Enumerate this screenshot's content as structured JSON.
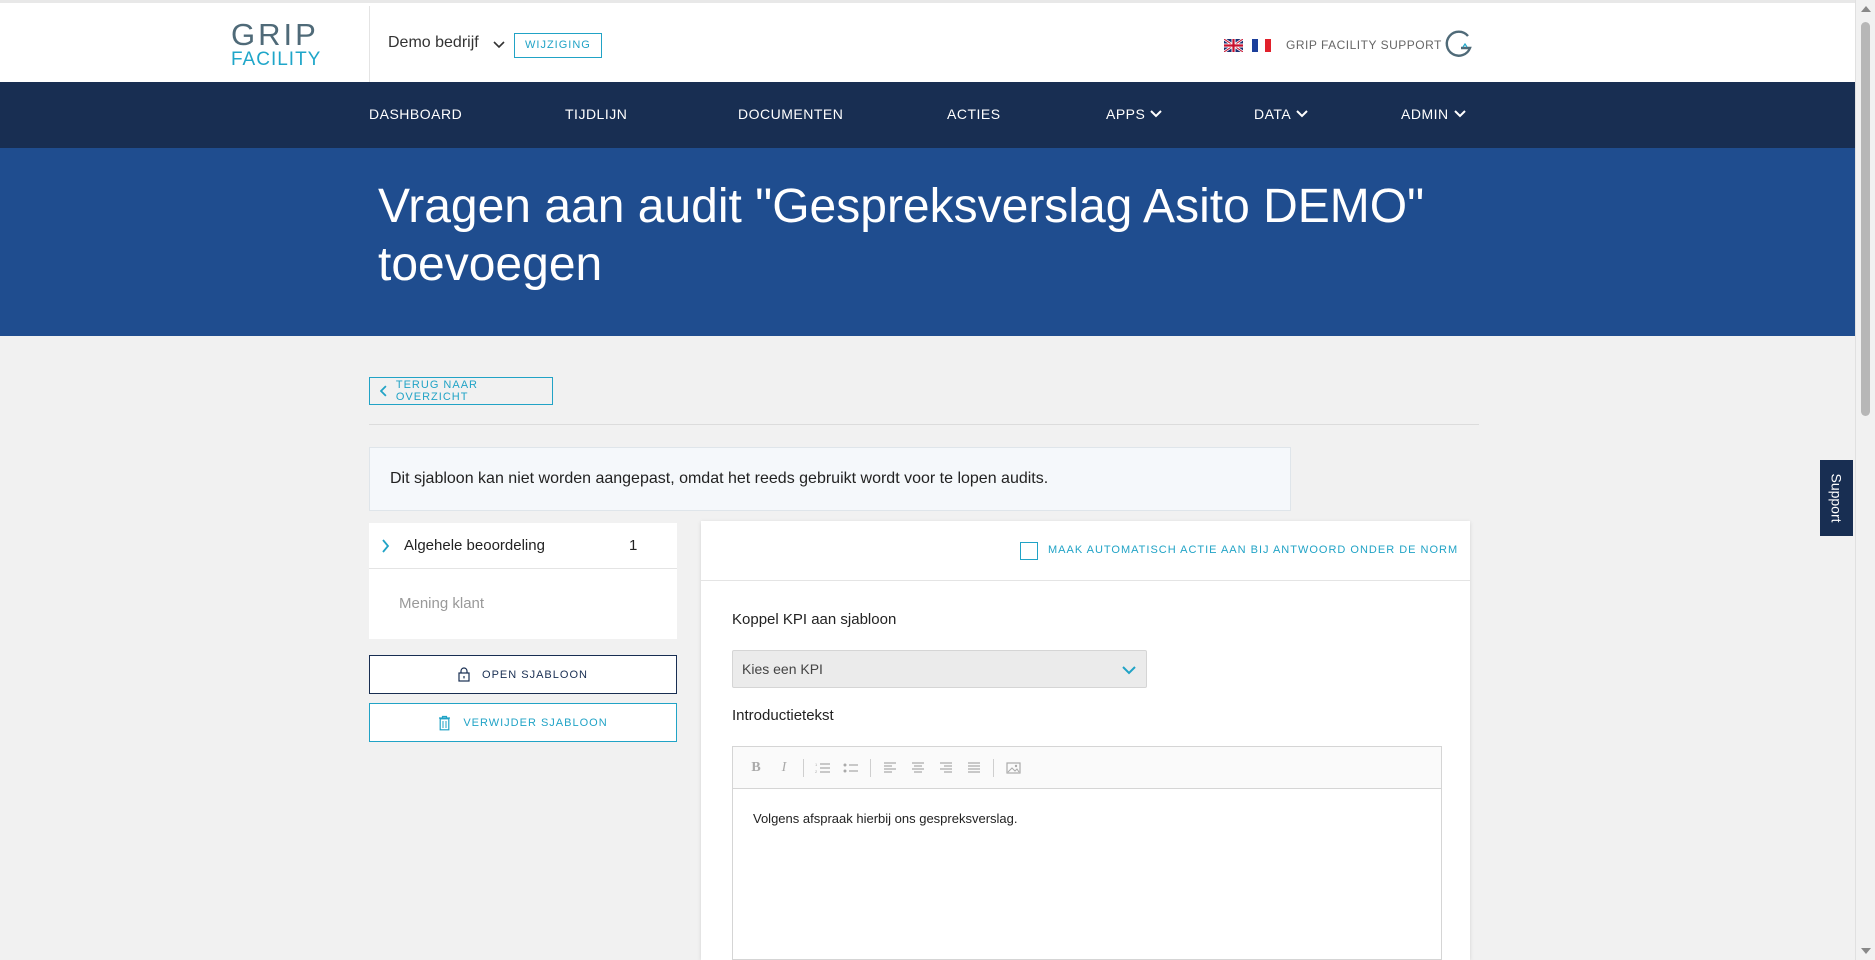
{
  "header": {
    "logo_top": "GRIP",
    "logo_bottom": "FACILITY",
    "company": "Demo bedrijf",
    "change_label": "WIJZIGING",
    "support_link": "GRIP FACILITY SUPPORT"
  },
  "nav": {
    "items": [
      {
        "label": "DASHBOARD",
        "dropdown": false
      },
      {
        "label": "TIJDLIJN",
        "dropdown": false
      },
      {
        "label": "DOCUMENTEN",
        "dropdown": false
      },
      {
        "label": "ACTIES",
        "dropdown": false
      },
      {
        "label": "APPS",
        "dropdown": true
      },
      {
        "label": "DATA",
        "dropdown": true
      },
      {
        "label": "ADMIN",
        "dropdown": true
      }
    ]
  },
  "page": {
    "title": "Vragen aan audit \"Gespreksverslag Asito DEMO\" toevoegen",
    "back_label": "TERUG NAAR OVERZICHT",
    "notice": "Dit sjabloon kan niet worden aangepast, omdat het reeds gebruikt wordt voor te lopen audits."
  },
  "sidebar": {
    "category": "Algehele beoordeling",
    "category_count": "1",
    "question": "Mening klant",
    "open_label": "OPEN SJABLOON",
    "delete_label": "VERWIJDER SJABLOON"
  },
  "form": {
    "auto_action_label": "MAAK AUTOMATISCH ACTIE AAN BIJ ANTWOORD ONDER DE NORM",
    "auto_action_checked": false,
    "kpi_label": "Koppel KPI aan sjabloon",
    "kpi_selected": "Kies een KPI",
    "intro_label": "Introductietekst",
    "intro_text": "Volgens afspraak hierbij ons gespreksverslag."
  },
  "support_tab": "Support",
  "colors": {
    "navy": "#182e52",
    "hero_blue": "#1f4d8f",
    "accent_teal": "#21a3c6"
  }
}
